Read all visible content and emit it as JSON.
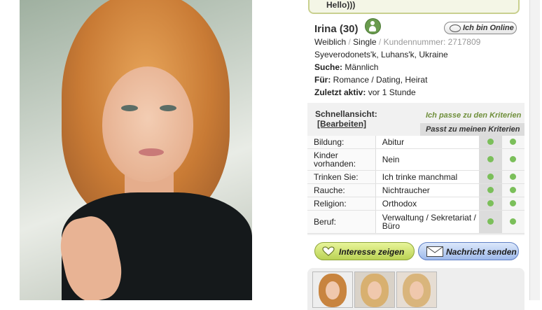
{
  "message_bubble": "Hello)))",
  "profile": {
    "name_age": "Irina (30)",
    "gender": "Weiblich",
    "status": "Single",
    "customer_label": "Kundennummer: 2717809",
    "location": "Syeverodonets'k, Luhans'k, Ukraine",
    "search_label": "Suche:",
    "search_value": "Männlich",
    "for_label": "Für:",
    "for_value": "Romance / Dating, Heirat",
    "last_active_label": "Zuletzt aktiv:",
    "last_active_value": "vor 1 Stunde"
  },
  "online_badge": "Ich bin Online",
  "quickview": {
    "label": "Schnellansicht:",
    "edit": "[Bearbeiten]",
    "criteria_a": "Ich passe zu den Kriterien",
    "criteria_b": "Passt zu meinen Kriterien",
    "rows": [
      {
        "key": "Bildung:",
        "value": "Abitur"
      },
      {
        "key": "Kinder vorhanden:",
        "value": "Nein"
      },
      {
        "key": "Trinken Sie:",
        "value": "Ich trinke manchmal"
      },
      {
        "key": "Rauche:",
        "value": "Nichtraucher"
      },
      {
        "key": "Religion:",
        "value": "Orthodox"
      },
      {
        "key": "Beruf:",
        "value": "Verwaltung / Sekretariat / Büro"
      }
    ]
  },
  "buttons": {
    "interest": "Interesse zeigen",
    "message": "Nachricht senden"
  },
  "colors": {
    "match_dot": "#7bbf5a",
    "interest_button": "#c9dd6a",
    "message_button": "#b5cbf0"
  }
}
